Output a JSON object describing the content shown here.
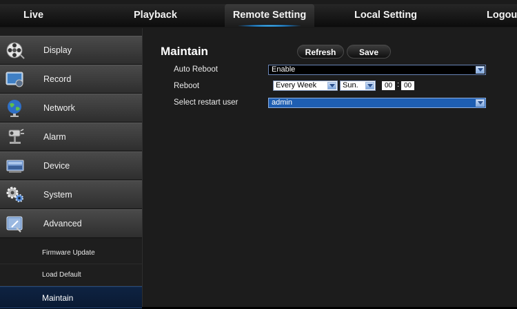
{
  "nav": {
    "tabs": [
      {
        "label": "Live"
      },
      {
        "label": "Playback"
      },
      {
        "label": "Remote Setting"
      },
      {
        "label": "Local Setting"
      },
      {
        "label": "Logou"
      }
    ],
    "active_tab": "Remote Setting"
  },
  "sidebar": {
    "items": [
      {
        "label": "Display",
        "icon": "display-reel-icon"
      },
      {
        "label": "Record",
        "icon": "record-monitor-icon"
      },
      {
        "label": "Network",
        "icon": "network-globe-icon"
      },
      {
        "label": "Alarm",
        "icon": "alarm-camera-icon"
      },
      {
        "label": "Device",
        "icon": "device-hdd-icon"
      },
      {
        "label": "System",
        "icon": "system-gears-icon"
      },
      {
        "label": "Advanced",
        "icon": "advanced-tools-icon"
      }
    ],
    "subitems": [
      {
        "label": "Firmware Update"
      },
      {
        "label": "Load Default"
      },
      {
        "label": "Maintain"
      }
    ],
    "active_subitem": "Maintain"
  },
  "main": {
    "title": "Maintain",
    "refresh_label": "Refresh",
    "save_label": "Save",
    "auto_reboot": {
      "label": "Auto Reboot",
      "value": "Enable"
    },
    "reboot": {
      "label": "Reboot",
      "frequency": "Every Week",
      "day": "Sun.",
      "hour": "00",
      "separator": ":",
      "minute": "00"
    },
    "restart_user": {
      "label": "Select restart user",
      "value": "admin"
    }
  },
  "colors": {
    "accent_blue": "#1e5eb2",
    "active_subitem_bg": "#0e2342",
    "tab_glow": "#5ad0ff"
  }
}
